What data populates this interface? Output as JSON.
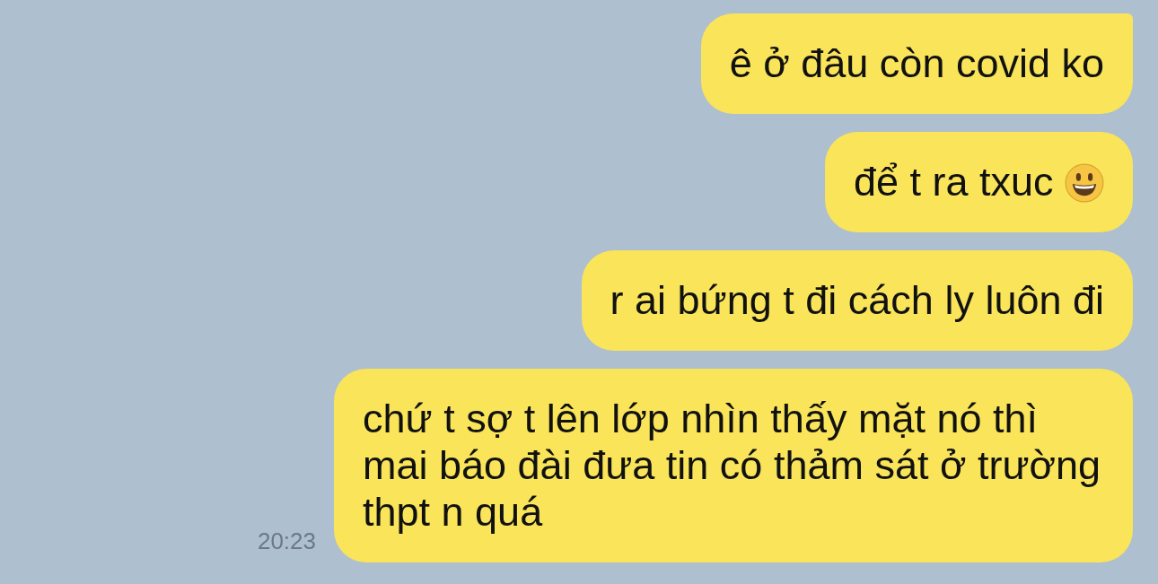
{
  "messages": [
    {
      "text": "ê ở đâu còn covid ko",
      "tail": true
    },
    {
      "text": "để t ra txuc",
      "tail": false,
      "smiley": true
    },
    {
      "text": "r ai bứng t đi cách ly luôn đi",
      "tail": false
    },
    {
      "text": "chứ t sợ t lên lớp nhìn thấy mặt nó thì mai báo đài đưa tin có thảm sát ở trường thpt n quá",
      "tail": false,
      "time": "20:23"
    }
  ]
}
